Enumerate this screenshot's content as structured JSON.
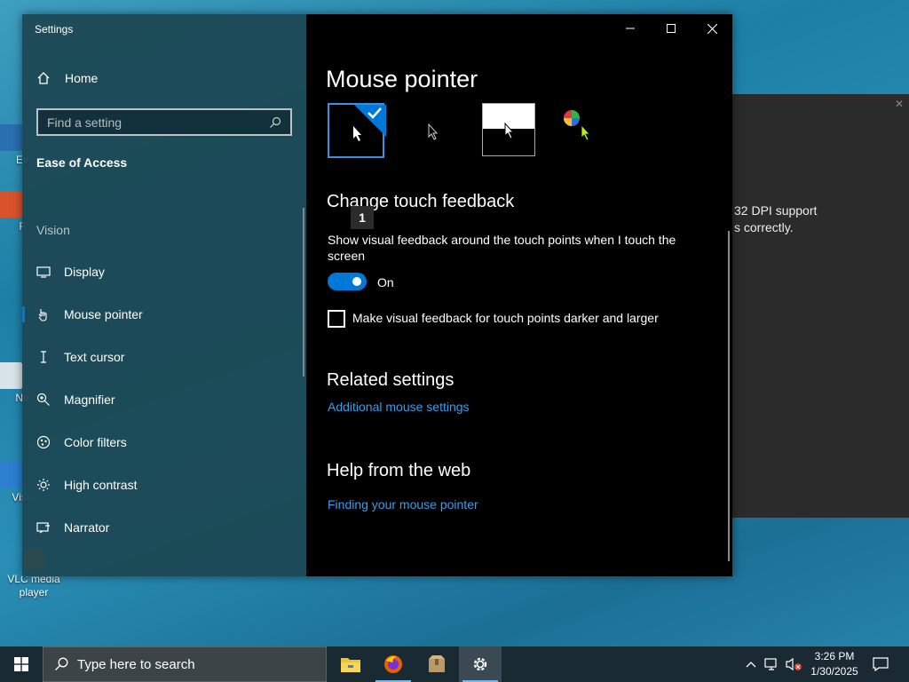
{
  "desktop": {
    "icons": [
      {
        "label": "Ev"
      },
      {
        "label": "F"
      },
      {
        "label": "No"
      },
      {
        "label": "Visu"
      },
      {
        "label": "VLC media player"
      }
    ]
  },
  "background_window": {
    "text_line1": "32 DPI support",
    "text_line2": "s correctly."
  },
  "settings": {
    "app_title": "Settings",
    "home_label": "Home",
    "search_placeholder": "Find a setting",
    "section_title": "Ease of Access",
    "group_label": "Vision",
    "nav_items": [
      {
        "label": "Display",
        "icon": "monitor-icon"
      },
      {
        "label": "Mouse pointer",
        "icon": "mouse-pointer-icon",
        "active": true
      },
      {
        "label": "Text cursor",
        "icon": "text-cursor-icon"
      },
      {
        "label": "Magnifier",
        "icon": "magnifier-icon"
      },
      {
        "label": "Color filters",
        "icon": "color-filters-icon"
      },
      {
        "label": "High contrast",
        "icon": "high-contrast-icon"
      },
      {
        "label": "Narrator",
        "icon": "narrator-icon"
      }
    ],
    "page_title": "Mouse pointer",
    "touch_feedback": {
      "heading": "Change touch feedback",
      "badge": "1",
      "description": "Show visual feedback around the touch points when I touch the screen",
      "toggle_state": "On",
      "checkbox_label": "Make visual feedback for touch points darker and larger"
    },
    "related": {
      "heading": "Related settings",
      "link": "Additional mouse settings"
    },
    "help": {
      "heading": "Help from the web",
      "link": "Finding your mouse pointer"
    },
    "accent_color": "#0078d7",
    "link_color": "#3a9ce8"
  },
  "taskbar": {
    "search_placeholder": "Type here to search",
    "apps": [
      "file-explorer-icon",
      "firefox-icon",
      "package-icon",
      "settings-gear-icon"
    ],
    "time": "3:26 PM",
    "date": "1/30/2025"
  }
}
